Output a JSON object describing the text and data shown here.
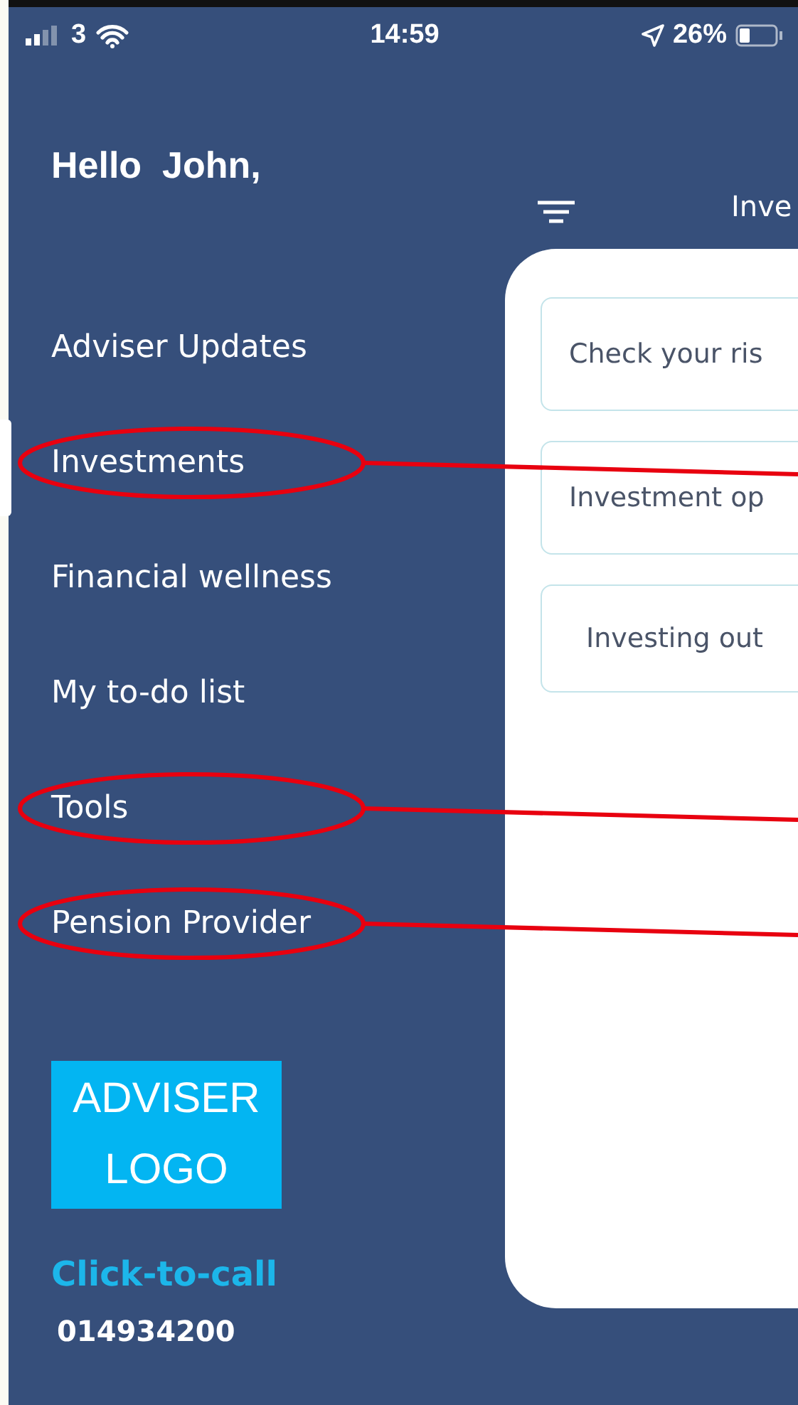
{
  "status_bar": {
    "carrier": "3",
    "time": "14:59",
    "battery": "26%"
  },
  "sidebar": {
    "greeting": "Hello  John,",
    "items": [
      {
        "label": "Adviser Updates",
        "circled": false
      },
      {
        "label": "Investments",
        "circled": true
      },
      {
        "label": "Financial wellness",
        "circled": false
      },
      {
        "label": "My to-do list",
        "circled": false
      },
      {
        "label": "Tools",
        "circled": true
      },
      {
        "label": "Pension Provider",
        "circled": true
      }
    ],
    "logo": [
      "ADVISER",
      "LOGO"
    ],
    "call_link": "Click-to-call",
    "phone": "014934200"
  },
  "content": {
    "title": "Inve",
    "cards": [
      {
        "label": "Check your ris"
      },
      {
        "label": "Investment op"
      },
      {
        "label": "Investing out"
      }
    ]
  }
}
